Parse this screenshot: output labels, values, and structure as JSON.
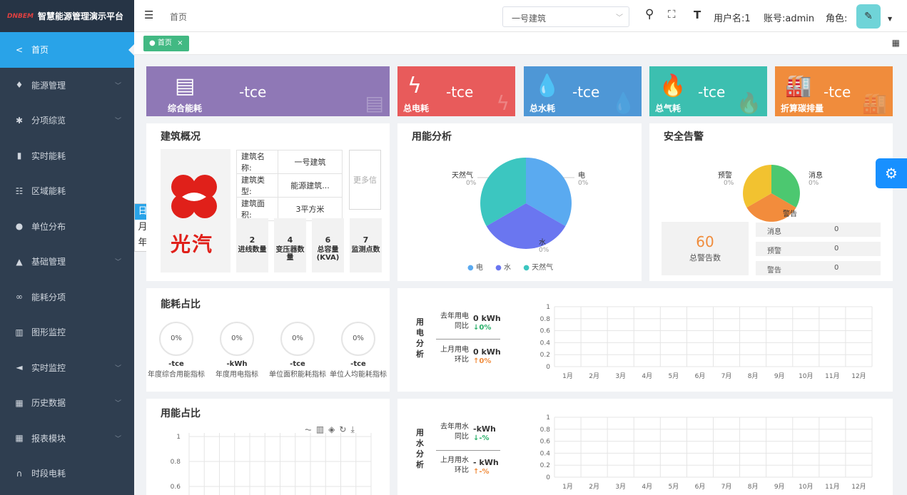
{
  "app": {
    "title": "智慧能源管理演示平台",
    "logo_text": "DNBEM"
  },
  "sidebar": {
    "items": [
      {
        "label": "首页",
        "icon": "share-icon",
        "active": true,
        "chevron": false
      },
      {
        "label": "能源管理",
        "icon": "pin-icon",
        "chevron": true
      },
      {
        "label": "分项综览",
        "icon": "asterisk-icon",
        "chevron": true
      },
      {
        "label": "实时能耗",
        "icon": "bookmark-icon",
        "chevron": false
      },
      {
        "label": "区域能耗",
        "icon": "users-icon",
        "chevron": false
      },
      {
        "label": "单位分布",
        "icon": "location-icon",
        "chevron": false
      },
      {
        "label": "基础管理",
        "icon": "graduation-cap-icon",
        "chevron": true
      },
      {
        "label": "能耗分项",
        "icon": "bicycle-icon",
        "chevron": false
      },
      {
        "label": "图形监控",
        "icon": "barcode-icon",
        "chevron": false
      },
      {
        "label": "实时监控",
        "icon": "megaphone-icon",
        "chevron": true
      },
      {
        "label": "历史数据",
        "icon": "grid-icon",
        "chevron": true
      },
      {
        "label": "报表模块",
        "icon": "calendar-icon",
        "chevron": true
      },
      {
        "label": "时段电耗",
        "icon": "binoculars-icon",
        "chevron": false
      }
    ]
  },
  "header": {
    "breadcrumb": "首页",
    "building_select": "一号建筑",
    "user_label": "用户名:1",
    "account_label": "账号:admin",
    "role_label": "角色:"
  },
  "tabs": [
    {
      "label": "首页",
      "closable": true
    }
  ],
  "period_tabs": [
    "日",
    "月",
    "年"
  ],
  "stats": [
    {
      "label": "综合能耗",
      "value": "-tce",
      "color": "#8f78b6"
    },
    {
      "label": "总电耗",
      "value": "-tce",
      "color": "#e85b5b"
    },
    {
      "label": "总水耗",
      "value": "-tce",
      "color": "#4e97d6"
    },
    {
      "label": "总气耗",
      "value": "-tce",
      "color": "#3cbfb0"
    },
    {
      "label": "折算碳排量",
      "value": "-tce",
      "color": "#f08c3c"
    }
  ],
  "building": {
    "title": "建筑概况",
    "logo_text": "光汽",
    "rows": [
      {
        "label": "建筑名称:",
        "value": "一号建筑"
      },
      {
        "label": "建筑类型:",
        "value": "能源建筑..."
      },
      {
        "label": "建筑面积:",
        "value": "3平方米"
      }
    ],
    "more": "更多信息",
    "counts": [
      {
        "value": "2",
        "label": "进线数量"
      },
      {
        "value": "4",
        "label": "变压器数量"
      },
      {
        "value": "6",
        "label": "总容量(KVA)"
      },
      {
        "value": "7",
        "label": "监测点数"
      }
    ]
  },
  "energy_analysis": {
    "title": "用能分析",
    "slices": [
      {
        "name": "电",
        "value": "0%",
        "color": "#5aaaf0"
      },
      {
        "name": "水",
        "value": "0%",
        "color": "#6a76f0"
      },
      {
        "name": "天然气",
        "value": "0%",
        "color": "#3cc6c0"
      }
    ],
    "legend": [
      "电",
      "水",
      "天然气"
    ]
  },
  "alarm": {
    "title": "安全告警",
    "slices": [
      {
        "name": "预警",
        "value": "0%",
        "color": "#f2c230"
      },
      {
        "name": "消息",
        "value": "0%",
        "color": "#4cc870"
      },
      {
        "name": "警告",
        "value": "",
        "color": "#f28c3c"
      }
    ],
    "total": "60",
    "total_label": "总警告数",
    "rows": [
      {
        "label": "消息",
        "value": "0"
      },
      {
        "label": "预警",
        "value": "0"
      },
      {
        "label": "警告",
        "value": "0"
      }
    ]
  },
  "energy_ratio": {
    "title": "能耗占比",
    "items": [
      {
        "percent": "0%",
        "value": "-tce",
        "label": "年度综合用能指标"
      },
      {
        "percent": "0%",
        "value": "-kWh",
        "label": "年度用电指标"
      },
      {
        "percent": "0%",
        "value": "-tce",
        "label": "单位面积能耗指标"
      },
      {
        "percent": "0%",
        "value": "-tce",
        "label": "单位人均能耗指标"
      }
    ]
  },
  "electric": {
    "side_label": "用电分析",
    "yoy_label": "去年用电同比",
    "yoy_value": "0 kWh",
    "yoy_pct": "↓0%",
    "mom_label": "上月用电环比",
    "mom_value": "0 kWh",
    "mom_pct": "↑0%"
  },
  "water": {
    "side_label": "用水分析",
    "yoy_label": "去年用水同比",
    "yoy_value": "-kWh",
    "yoy_pct": "↓-%",
    "mom_label": "上月用水环比",
    "mom_value": "- kWh",
    "mom_pct": "↑-%"
  },
  "usage_ratio": {
    "title": "用能占比"
  },
  "chart_data": [
    {
      "type": "bar",
      "categories": [
        "1月",
        "2月",
        "3月",
        "4月",
        "5月",
        "6月",
        "7月",
        "8月",
        "9月",
        "10月",
        "11月",
        "12月"
      ],
      "values": [],
      "yticks": [
        "0",
        "0.2",
        "0.4",
        "0.6",
        "0.8",
        "1"
      ],
      "ylim": [
        0,
        1
      ],
      "grid": true
    },
    {
      "type": "bar",
      "categories": [
        "1月",
        "2月",
        "3月",
        "4月",
        "5月",
        "6月",
        "7月",
        "8月",
        "9月",
        "10月",
        "11月",
        "12月"
      ],
      "values": [],
      "yticks": [
        "0",
        "0.2",
        "0.4",
        "0.6",
        "0.8",
        "1"
      ],
      "ylim": [
        0,
        1
      ],
      "grid": true
    },
    {
      "type": "line",
      "values": [],
      "yticks": [
        "1",
        "0.8",
        "0.6"
      ],
      "grid": true
    }
  ]
}
